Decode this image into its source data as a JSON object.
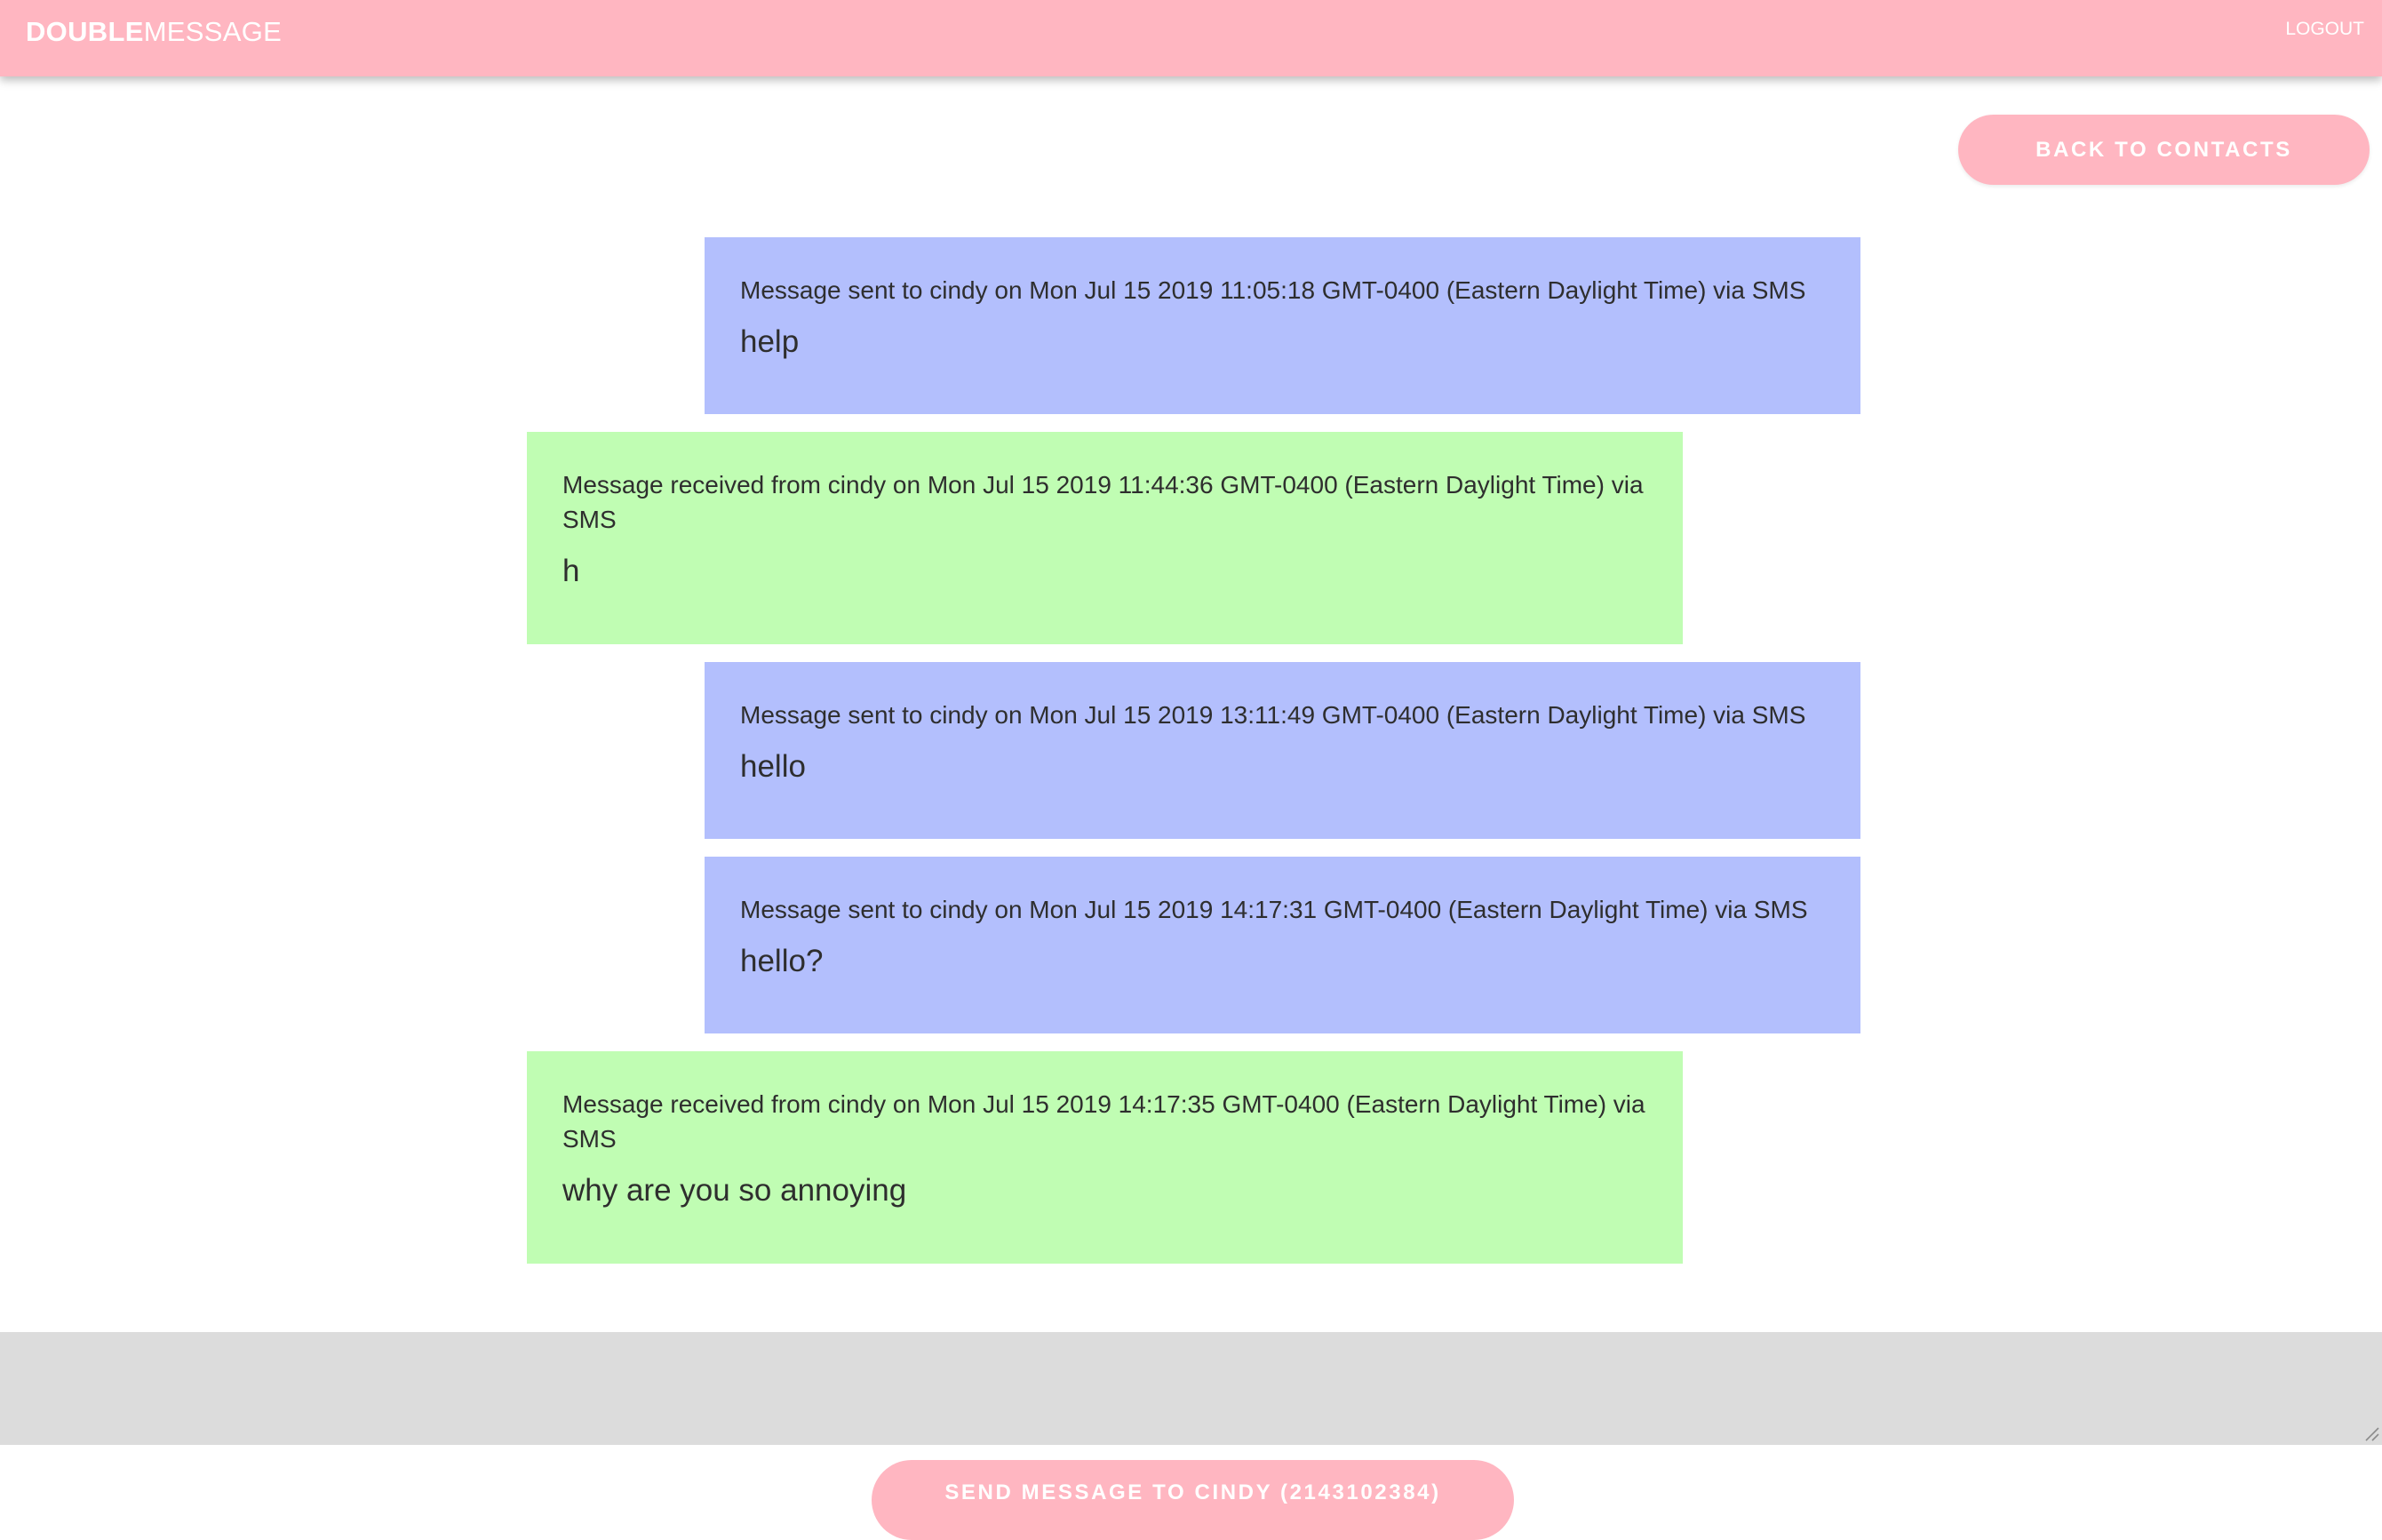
{
  "navbar": {
    "brand_bold": "DOUBLE",
    "brand_light": "MESSAGE",
    "logout_label": "LOGOUT"
  },
  "actions": {
    "back_label": "BACK TO CONTACTS",
    "send_label": "SEND MESSAGE TO CINDY (2143102384)"
  },
  "compose": {
    "value": "",
    "placeholder": ""
  },
  "colors": {
    "brand_pink": "#ffb6c1",
    "sent_bubble": "#b3bffd",
    "received_bubble": "#c0fdb3",
    "compose_background": "#dcdcdc"
  },
  "messages": [
    {
      "direction": "sent",
      "meta": "Message sent to cindy on Mon Jul 15 2019 11:05:18 GMT-0400 (Eastern Daylight Time) via SMS",
      "body": "help"
    },
    {
      "direction": "received",
      "meta": "Message received from cindy on Mon Jul 15 2019 11:44:36 GMT-0400 (Eastern Daylight Time) via SMS",
      "body": "h"
    },
    {
      "direction": "sent",
      "meta": "Message sent to cindy on Mon Jul 15 2019 13:11:49 GMT-0400 (Eastern Daylight Time) via SMS",
      "body": "hello"
    },
    {
      "direction": "sent",
      "meta": "Message sent to cindy on Mon Jul 15 2019 14:17:31 GMT-0400 (Eastern Daylight Time) via SMS",
      "body": "hello?"
    },
    {
      "direction": "received",
      "meta": "Message received from cindy on Mon Jul 15 2019 14:17:35 GMT-0400 (Eastern Daylight Time) via SMS",
      "body": "why are you so annoying"
    }
  ]
}
